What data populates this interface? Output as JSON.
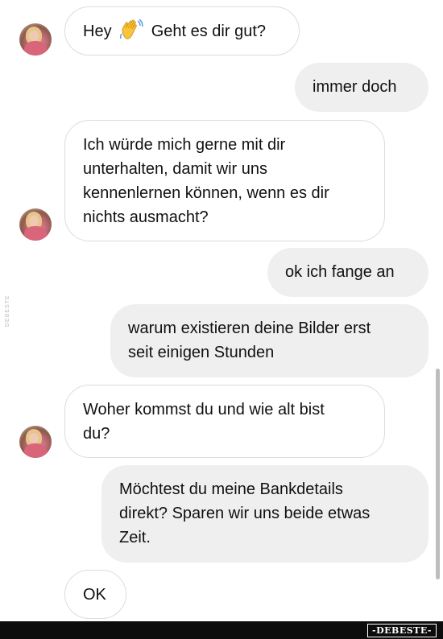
{
  "messages": [
    {
      "direction": "incoming",
      "text_before": "Hey",
      "emoji": "waving-hand-icon",
      "text_after": "Geht es dir gut?"
    },
    {
      "direction": "outgoing",
      "text": "immer doch"
    },
    {
      "direction": "incoming",
      "text": "Ich würde mich gerne mit dir\nunterhalten, damit wir uns\nkennenlernen können, wenn es dir\nnichts ausmacht?"
    },
    {
      "direction": "outgoing",
      "text": "ok ich fange an"
    },
    {
      "direction": "outgoing",
      "text": "warum existieren deine Bilder erst\nseit einigen Stunden"
    },
    {
      "direction": "incoming",
      "text": "Woher kommst du und wie alt bist\ndu?"
    },
    {
      "direction": "outgoing",
      "text": "Möchtest du meine Bankdetails\ndirekt? Sparen wir uns beide etwas\nZeit."
    },
    {
      "direction": "incoming",
      "text": "OK"
    }
  ],
  "watermark": {
    "side_text": "DEBESTE",
    "logo_text": "-DEBESTE-"
  },
  "colors": {
    "incoming_bubble": "#ffffff",
    "incoming_border": "#dcdcdc",
    "outgoing_bubble": "#efefef",
    "text": "#111111",
    "bottom_bar": "#0c0c0c"
  }
}
